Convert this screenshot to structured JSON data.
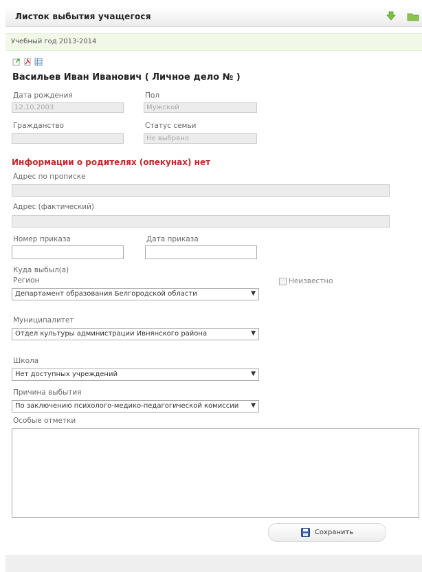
{
  "window": {
    "title": "Листок выбытия учащегося"
  },
  "toolbar": {
    "down_icon": "arrow-down-icon",
    "folder_icon": "folder-icon"
  },
  "year": {
    "text": "Учебный год 2013-2014"
  },
  "actions": {
    "icons": [
      "export-icon",
      "pdf-icon",
      "excel-icon"
    ]
  },
  "student": {
    "name": "Васильев Иван Иванович ( Личное дело № )"
  },
  "fields": {
    "birth_date": {
      "label": "Дата рождения",
      "value": "12.10.2003"
    },
    "gender": {
      "label": "Пол",
      "value": "Мужской"
    },
    "citizenship": {
      "label": "Гражданство",
      "value": ""
    },
    "family_status": {
      "label": "Статус семьи",
      "value": "Не выбрано"
    }
  },
  "parents_warning": "Информации о родителях (опекунах) нет",
  "addresses": {
    "registration": {
      "label": "Адрес по прописке",
      "value": ""
    },
    "actual": {
      "label": "Адрес (фактический)",
      "value": ""
    }
  },
  "order": {
    "number": {
      "label": "Номер приказа",
      "value": ""
    },
    "date": {
      "label": "Дата приказа",
      "value": ""
    }
  },
  "destination": {
    "heading": "Куда выбыл(а)",
    "region": {
      "label": "Регион",
      "value": "Департамент образования Белгородской области"
    },
    "unknown_label": "Неизвестно",
    "municipality": {
      "label": "Муниципалитет",
      "value": "Отдел культуры администрации Ивнянского района"
    },
    "school": {
      "label": "Школа",
      "value": "Нет доступных учреждений"
    },
    "reason": {
      "label": "Причина выбытия",
      "value": "По заключению психолого-медико-педагогической комиссии"
    }
  },
  "notes": {
    "label": "Особые отметки",
    "value": ""
  },
  "buttons": {
    "save_label": "Сохранить",
    "save_icon": "floppy-disk-icon"
  },
  "colors": {
    "accent_green": "#7cc242",
    "warning_red": "#c0282a",
    "year_bar": "#f2f8e8"
  }
}
